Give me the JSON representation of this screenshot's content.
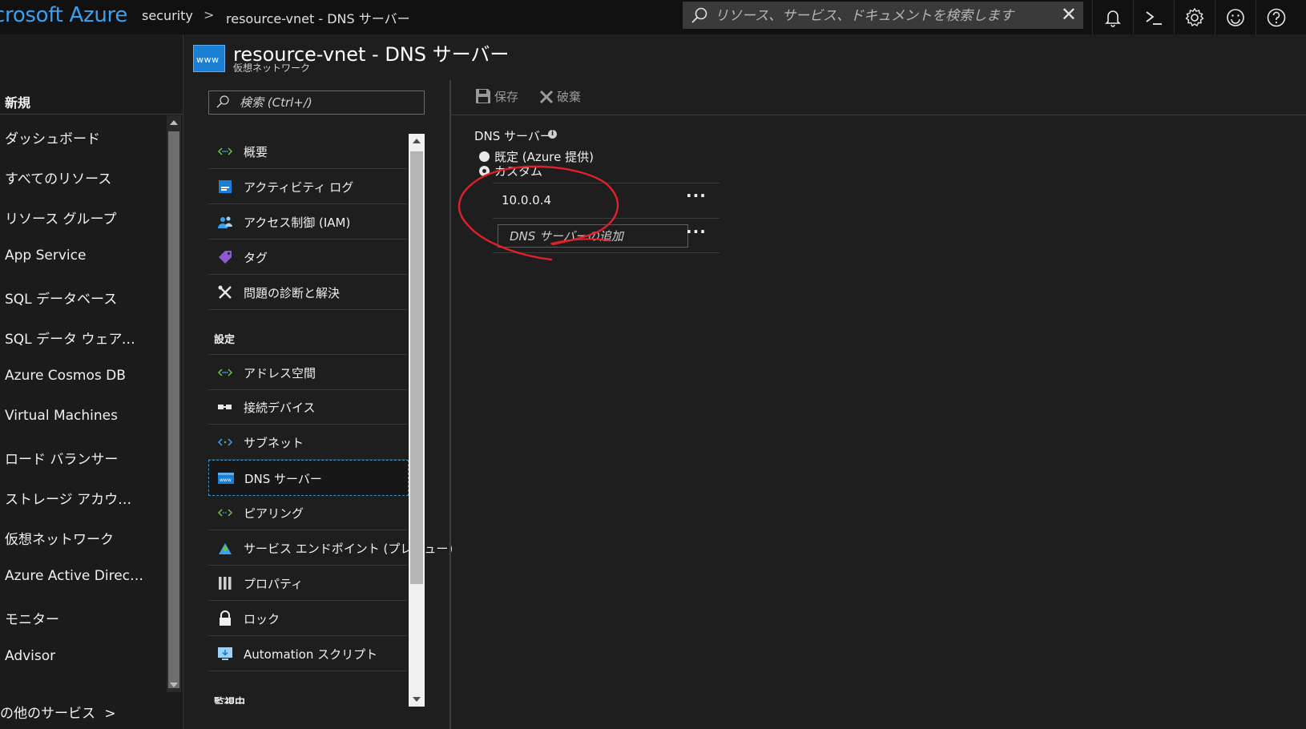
{
  "topbar": {
    "brand": "crosoft Azure",
    "breadcrumb": [
      "security",
      "resource-vnet - DNS サーバー"
    ],
    "breadcrumb_sep": ">",
    "search_placeholder": "リソース、サービス、ドキュメントを検索します",
    "clear": "✕",
    "icons": [
      "bell-icon",
      "cloud-shell-icon",
      "gear-icon",
      "smiley-icon",
      "help-icon"
    ]
  },
  "leftnav": {
    "new": "新規",
    "items": [
      "ダッシュボード",
      "すべてのリソース",
      "リソース グループ",
      "App Service",
      "SQL データベース",
      "SQL データ ウェアハウス",
      "Azure Cosmos DB",
      "Virtual Machines",
      "ロード バランサー",
      "ストレージ アカウント",
      "仮想ネットワーク",
      "Azure Active Direct…",
      "モニター",
      "Advisor"
    ],
    "more": "の他のサービス",
    "more_chevron": ">"
  },
  "blade": {
    "icon_text": "www",
    "title": "resource-vnet - DNS サーバー",
    "subtitle": "仮想ネットワーク"
  },
  "menu": {
    "search_placeholder": "検索 (Ctrl+/)",
    "items": [
      {
        "label": "概要",
        "icon": "network-icon"
      },
      {
        "label": "アクティビティ ログ",
        "icon": "activity-log-icon"
      },
      {
        "label": "アクセス制御 (IAM)",
        "icon": "people-icon"
      },
      {
        "label": "タグ",
        "icon": "tag-icon"
      },
      {
        "label": "問題の診断と解決",
        "icon": "wrench-icon"
      }
    ],
    "section_settings": "設定",
    "settings_items": [
      {
        "label": "アドレス空間",
        "icon": "network-icon"
      },
      {
        "label": "接続デバイス",
        "icon": "plug-icon"
      },
      {
        "label": "サブネット",
        "icon": "subnet-icon"
      },
      {
        "label": "DNS サーバー",
        "icon": "dns-icon",
        "selected": true
      },
      {
        "label": "ピアリング",
        "icon": "peering-icon"
      },
      {
        "label": "サービス エンドポイント (プレビュー)",
        "icon": "endpoint-icon"
      },
      {
        "label": "プロパティ",
        "icon": "properties-icon"
      },
      {
        "label": "ロック",
        "icon": "lock-icon"
      },
      {
        "label": "Automation スクリプト",
        "icon": "automation-icon"
      }
    ],
    "section_monitoring": "監視中"
  },
  "content": {
    "save": "保存",
    "discard": "破棄",
    "dns_label": "DNS サーバー",
    "info": "i",
    "option_default": "既定 (Azure 提供)",
    "option_custom": "カスタム",
    "selected_option": "カスタム",
    "dns_servers": [
      "10.0.0.4"
    ],
    "ellipsis": "···",
    "add_placeholder": "DNS サーバーの追加"
  },
  "colors": {
    "brand": "#3aa0f0",
    "topbar": "#111111",
    "background": "#1e1e1e",
    "annotation": "#e0202a",
    "selected_border": "#3f96c8"
  }
}
